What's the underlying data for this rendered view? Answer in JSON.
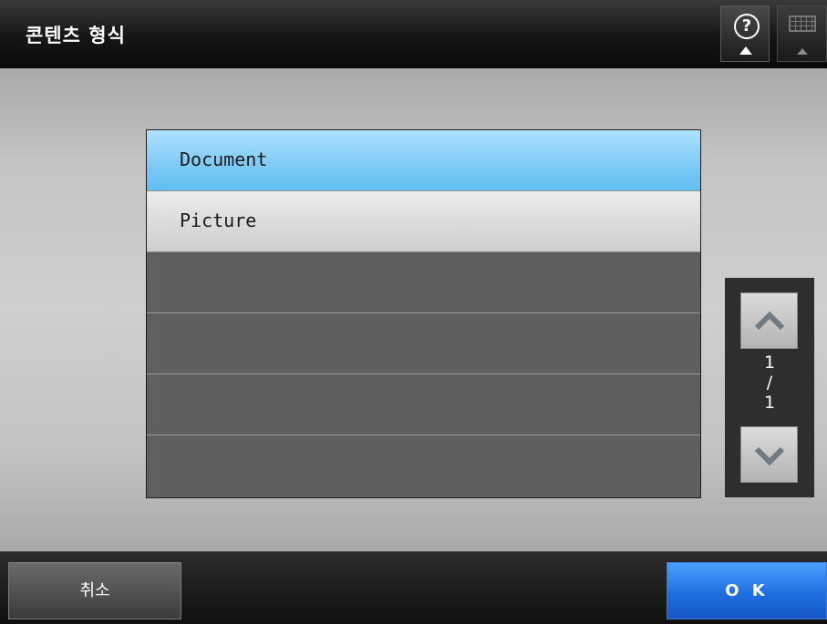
{
  "header": {
    "title": "콘텐츠 형식",
    "help_icon": "question-mark-icon",
    "keyboard_icon": "keyboard-icon"
  },
  "list": {
    "items": [
      {
        "label": "Document",
        "selected": true
      },
      {
        "label": "Picture",
        "selected": false
      },
      {
        "label": ""
      },
      {
        "label": ""
      },
      {
        "label": ""
      },
      {
        "label": ""
      }
    ]
  },
  "pager": {
    "current": "1",
    "separator": "/",
    "total": "1",
    "up_icon": "chevron-up-icon",
    "down_icon": "chevron-down-icon"
  },
  "footer": {
    "cancel_label": "취소",
    "ok_label": "O K"
  },
  "colors": {
    "selected_row": "#7ccaf5",
    "ok_button": "#1f6fe0"
  }
}
